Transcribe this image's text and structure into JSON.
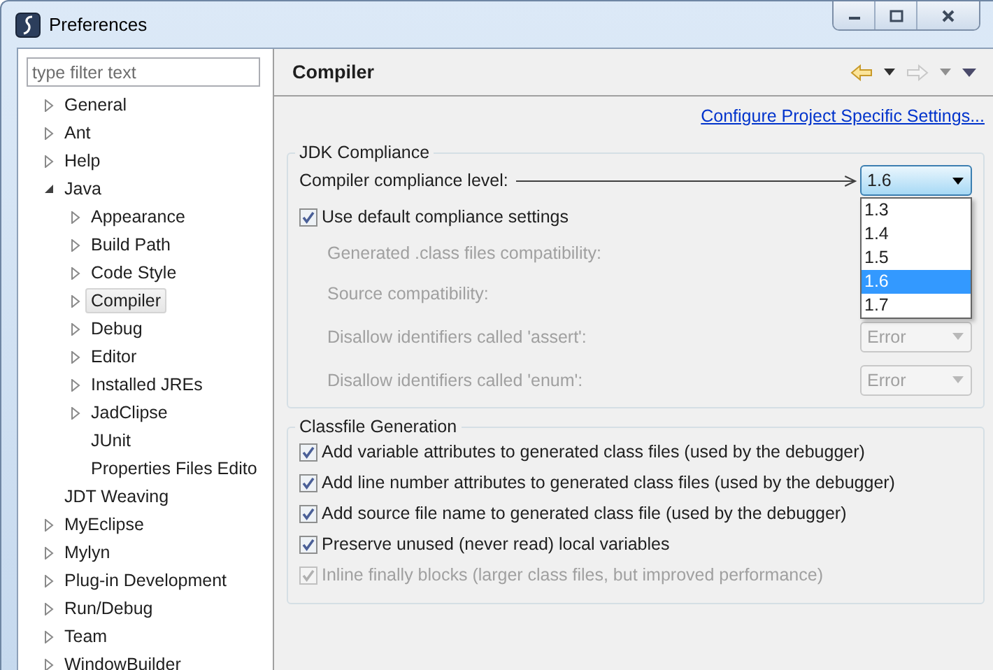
{
  "window": {
    "title": "Preferences"
  },
  "filter": {
    "placeholder": "type filter text"
  },
  "tree": [
    {
      "label": "General",
      "expanded": false,
      "selected": false
    },
    {
      "label": "Ant",
      "expanded": false,
      "selected": false
    },
    {
      "label": "Help",
      "expanded": false,
      "selected": false
    },
    {
      "label": "Java",
      "expanded": true,
      "selected": false,
      "children": [
        {
          "label": "Appearance",
          "expanded": false,
          "selected": false
        },
        {
          "label": "Build Path",
          "expanded": false,
          "selected": false
        },
        {
          "label": "Code Style",
          "expanded": false,
          "selected": false
        },
        {
          "label": "Compiler",
          "expanded": false,
          "selected": true
        },
        {
          "label": "Debug",
          "expanded": false,
          "selected": false
        },
        {
          "label": "Editor",
          "expanded": false,
          "selected": false
        },
        {
          "label": "Installed JREs",
          "expanded": false,
          "selected": false
        },
        {
          "label": "JadClipse",
          "expanded": false,
          "selected": false
        },
        {
          "label": "JUnit",
          "selected": false
        },
        {
          "label": "Properties Files Edito",
          "selected": false
        }
      ]
    },
    {
      "label": "JDT Weaving",
      "selected": false
    },
    {
      "label": "MyEclipse",
      "expanded": false,
      "selected": false
    },
    {
      "label": "Mylyn",
      "expanded": false,
      "selected": false
    },
    {
      "label": "Plug-in Development",
      "expanded": false,
      "selected": false
    },
    {
      "label": "Run/Debug",
      "expanded": false,
      "selected": false
    },
    {
      "label": "Team",
      "expanded": false,
      "selected": false
    },
    {
      "label": "WindowBuilder",
      "expanded": false,
      "selected": false
    }
  ],
  "page": {
    "title": "Compiler",
    "link": "Configure Project Specific Settings..."
  },
  "jdk_compliance": {
    "title": "JDK Compliance",
    "compliance_level": {
      "label": "Compiler compliance level:",
      "value": "1.6",
      "expanded": true,
      "options": [
        {
          "label": "1.3",
          "selected": false
        },
        {
          "label": "1.4",
          "selected": false
        },
        {
          "label": "1.5",
          "selected": false
        },
        {
          "label": "1.6",
          "selected": true
        },
        {
          "label": "1.7",
          "selected": false
        }
      ]
    },
    "use_default": {
      "label": "Use default compliance settings",
      "checked": true
    },
    "settings": [
      {
        "label": "Generated .class files compatibility:",
        "disabled": true
      },
      {
        "label": "Source compatibility:",
        "disabled": true
      },
      {
        "label": "Disallow identifiers called 'assert':",
        "disabled": true,
        "value": "Error"
      },
      {
        "label": "Disallow identifiers called 'enum':",
        "disabled": true,
        "value": "Error"
      }
    ]
  },
  "classfile_generation": {
    "title": "Classfile Generation",
    "options": [
      {
        "label": "Add variable attributes to generated class files (used by the debugger)",
        "checked": true,
        "disabled": false
      },
      {
        "label": "Add line number attributes to generated class files (used by the debugger)",
        "checked": true,
        "disabled": false
      },
      {
        "label": "Add source file name to generated class file (used by the debugger)",
        "checked": true,
        "disabled": false
      },
      {
        "label": "Preserve unused (never read) local variables",
        "checked": true,
        "disabled": false
      },
      {
        "label": "Inline finally blocks (larger class files, but improved performance)",
        "checked": true,
        "disabled": true
      }
    ]
  }
}
